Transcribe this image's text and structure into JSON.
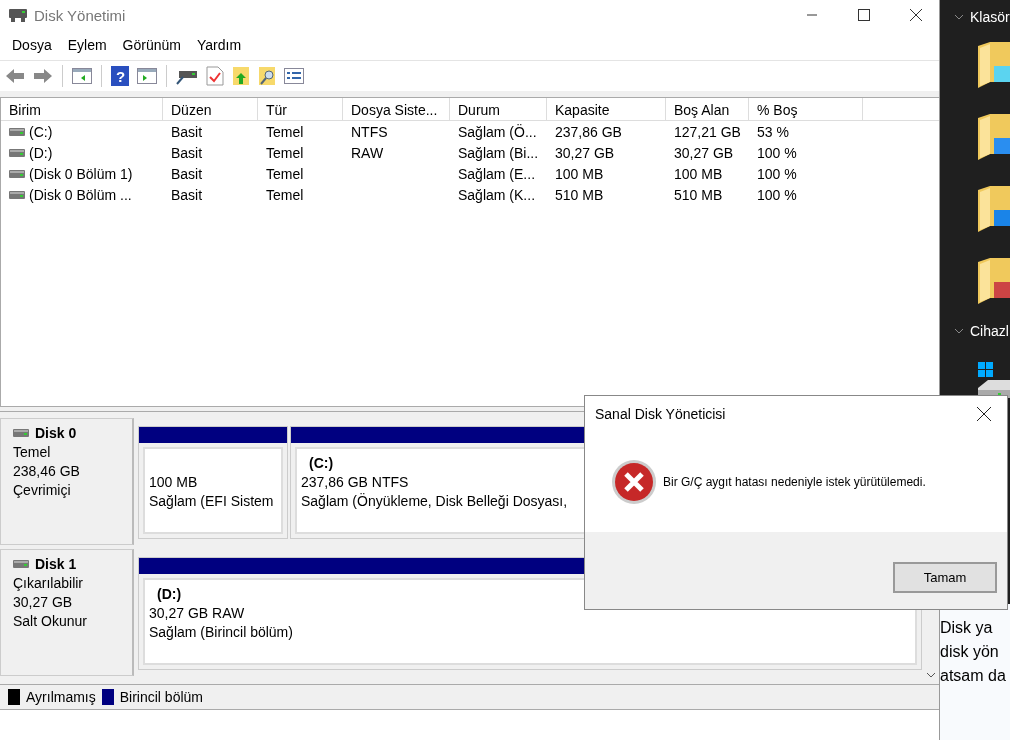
{
  "window": {
    "title": "Disk Yönetimi"
  },
  "menu": [
    "Dosya",
    "Eylem",
    "Görünüm",
    "Yardım"
  ],
  "toolbar": {
    "help_glyph": "?"
  },
  "volume_table": {
    "columns": [
      "Birim",
      "Düzen",
      "Tür",
      "Dosya Siste...",
      "Durum",
      "Kapasite",
      "Boş Alan",
      "% Boş"
    ],
    "rows": [
      {
        "cells": [
          "(C:)",
          "Basit",
          "Temel",
          "NTFS",
          "Sağlam (Ö...",
          "237,86 GB",
          "127,21 GB",
          "53 %"
        ]
      },
      {
        "cells": [
          "(D:)",
          "Basit",
          "Temel",
          "RAW",
          "Sağlam (Bi...",
          "30,27 GB",
          "30,27 GB",
          "100 %"
        ]
      },
      {
        "cells": [
          "(Disk 0 Bölüm 1)",
          "Basit",
          "Temel",
          "",
          "Sağlam (E...",
          "100 MB",
          "100 MB",
          "100 %"
        ]
      },
      {
        "cells": [
          "(Disk 0 Bölüm ...",
          "Basit",
          "Temel",
          "",
          "Sağlam (K...",
          "510 MB",
          "510 MB",
          "100 %"
        ]
      }
    ]
  },
  "disks": [
    {
      "name": "Disk 0",
      "type": "Temel",
      "size": "238,46 GB",
      "status": "Çevrimiçi",
      "partitions": [
        {
          "size": "100 MB",
          "status": "Sağlam (EFI Sistem"
        },
        {
          "label": "(C:)",
          "size": "237,86 GB NTFS",
          "status": "Sağlam (Önyükleme, Disk Belleği Dosyası,"
        }
      ]
    },
    {
      "name": "Disk 1",
      "type": "Çıkarılabilir",
      "size": "30,27 GB",
      "status": "Salt Okunur",
      "partitions": [
        {
          "label": "(D:)",
          "size": "30,27 GB RAW",
          "status": "Sağlam (Birincil bölüm)"
        }
      ]
    }
  ],
  "legend": [
    {
      "label": "Ayrılmamış",
      "color": "#000000"
    },
    {
      "label": "Birincil bölüm",
      "color": "#000080"
    }
  ],
  "dialog": {
    "title": "Sanal Disk Yöneticisi",
    "message": "Bir G/Ç aygıt hatası nedeniyle istek yürütülemedi.",
    "button": "Tamam"
  },
  "side_panel": {
    "sections": [
      "Klasör",
      "Cihazl"
    ],
    "text_lines": [
      "Disk ya",
      "disk yön",
      "atsam da"
    ]
  }
}
